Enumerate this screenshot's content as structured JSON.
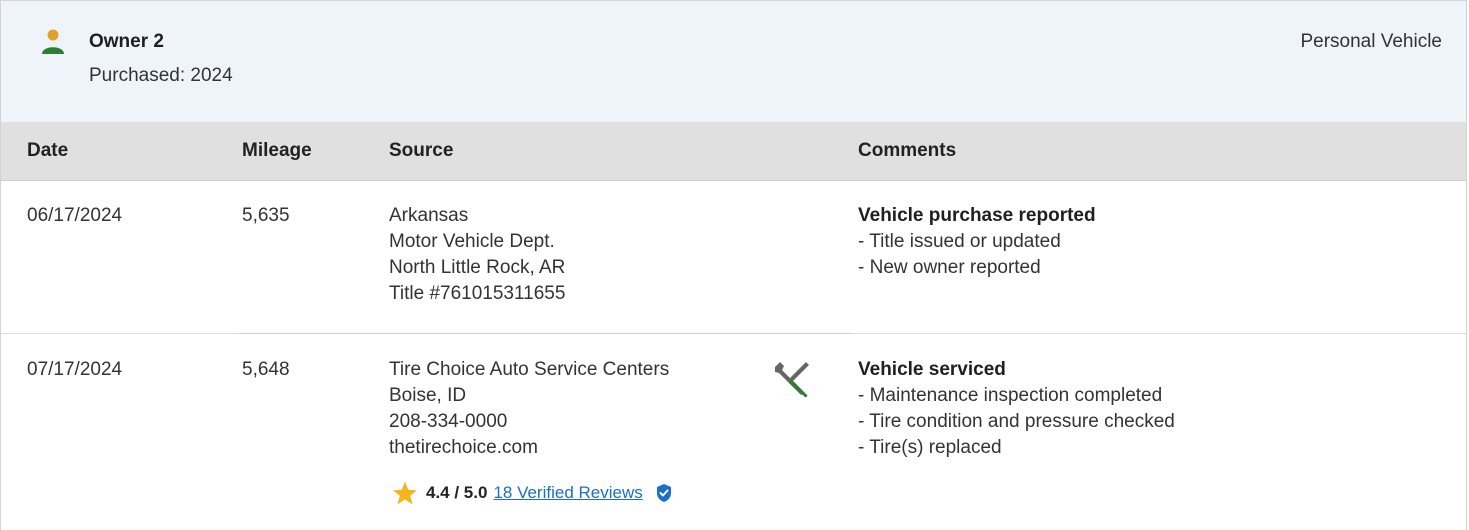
{
  "owner": {
    "name": "Owner 2",
    "purchased": "Purchased: 2024",
    "vehicle_type": "Personal Vehicle",
    "icon": "person-icon",
    "icon_colors": {
      "head": "#e0a12a",
      "body": "#2e7d32"
    }
  },
  "table": {
    "headers": {
      "date": "Date",
      "mileage": "Mileage",
      "source": "Source",
      "comments": "Comments"
    },
    "rows": [
      {
        "date": "06/17/2024",
        "mileage": "5,635",
        "source": [
          "Arkansas",
          "Motor Vehicle Dept.",
          "North Little Rock, AR",
          "Title #761015311655"
        ],
        "comment_title": "Vehicle purchase reported",
        "comments": [
          "- Title issued or updated",
          "- New owner reported"
        ]
      },
      {
        "date": "07/17/2024",
        "mileage": "5,648",
        "source": [
          "Tire Choice Auto Service Centers",
          "Boise, ID",
          "208-334-0000",
          "thetirechoice.com"
        ],
        "source_icon": "wrench-screwdriver-icon",
        "rating": {
          "value": "4.4 / 5.0",
          "reviews_link": "18 Verified Reviews",
          "star_icon": "star-icon",
          "verified_icon": "verified-shield-icon"
        },
        "comment_title": "Vehicle serviced",
        "comments": [
          "- Maintenance inspection completed",
          "- Tire condition and pressure checked",
          "- Tire(s) replaced"
        ]
      }
    ]
  },
  "colors": {
    "header_bg": "#eef4fa",
    "table_head_bg": "#e0e0e0",
    "link": "#1a6fc7",
    "star": "#f5b51c",
    "verified": "#1a6fc7",
    "tool_gray": "#666666",
    "tool_green": "#2e7d32"
  }
}
